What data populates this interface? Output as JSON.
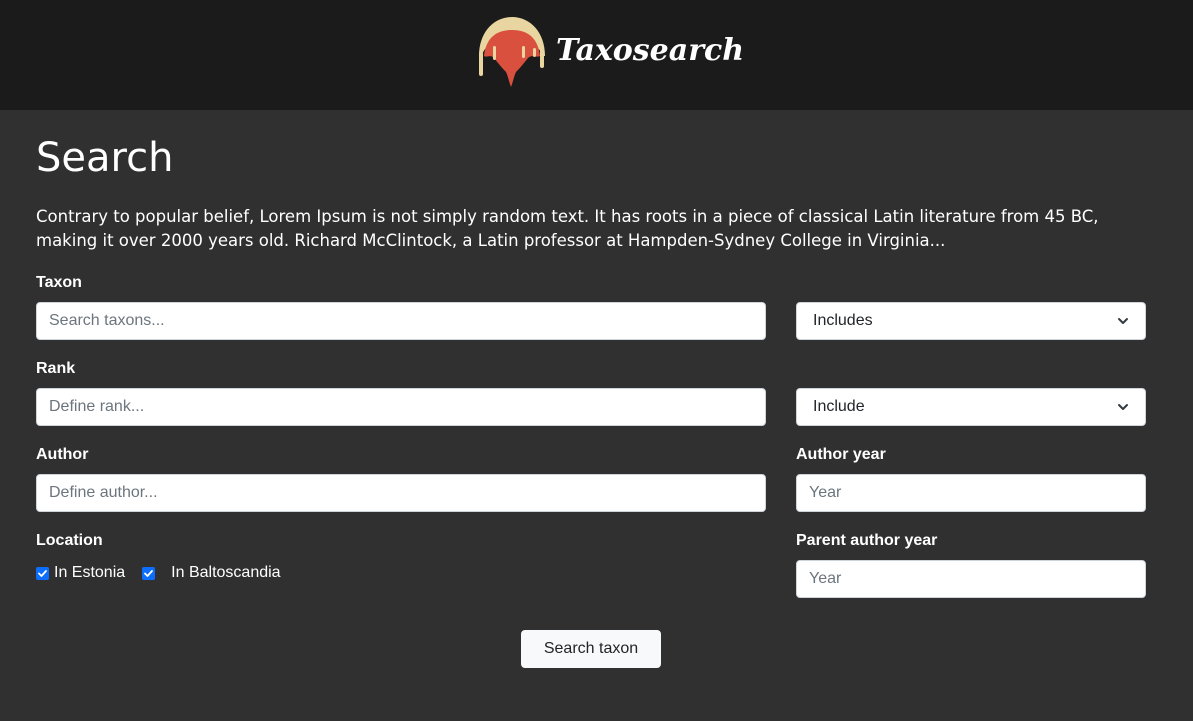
{
  "header": {
    "brand_name": "Taxosearch",
    "logo_icon": "dripping-mushroom-cap-logo",
    "logo_colors": {
      "cap": "#e8d5a0",
      "drip": "#d9503f"
    }
  },
  "page": {
    "title": "Search",
    "intro": "Contrary to popular belief, Lorem Ipsum is not simply random text. It has roots in a piece of classical Latin literature from 45 BC, making it over 2000 years old. Richard McClintock, a Latin professor at Hampden-Sydney College in Virginia..."
  },
  "form": {
    "taxon": {
      "label": "Taxon",
      "placeholder": "Search taxons...",
      "value": "",
      "mode_selected": "Includes"
    },
    "rank": {
      "label": "Rank",
      "placeholder": "Define rank...",
      "value": "",
      "mode_selected": "Include"
    },
    "author": {
      "label": "Author",
      "placeholder": "Define author...",
      "value": ""
    },
    "author_year": {
      "label": "Author year",
      "placeholder": "Year",
      "value": ""
    },
    "location": {
      "label": "Location",
      "options": [
        {
          "label": "In Estonia",
          "checked": true
        },
        {
          "label": "In Baltoscandia",
          "checked": true
        }
      ]
    },
    "parent_author_year": {
      "label": "Parent author year",
      "placeholder": "Year",
      "value": ""
    },
    "submit_label": "Search taxon"
  },
  "colors": {
    "header_bg": "#1b1b1b",
    "page_bg": "#303030",
    "checkbox_accent": "#0d6efd",
    "button_bg": "#f8f9fa"
  }
}
